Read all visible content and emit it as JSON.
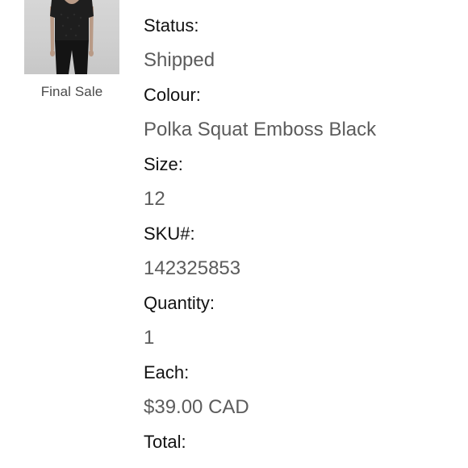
{
  "product": {
    "thumbnail_icon": "product-photo-black-top-leggings",
    "badge": "Final Sale"
  },
  "details": {
    "status_label": "Status:",
    "status_value": "Shipped",
    "colour_label": "Colour:",
    "colour_value": "Polka Squat Emboss Black",
    "size_label": "Size:",
    "size_value": "12",
    "sku_label": "SKU#:",
    "sku_value": "142325853",
    "quantity_label": "Quantity:",
    "quantity_value": "1",
    "each_label": "Each:",
    "each_value": "$39.00 CAD",
    "total_label": "Total:"
  },
  "colors": {
    "label_text": "#111111",
    "value_text": "#5c5c5c",
    "photo_background": "#d0d0d0",
    "garment": "#1c1c1c"
  }
}
